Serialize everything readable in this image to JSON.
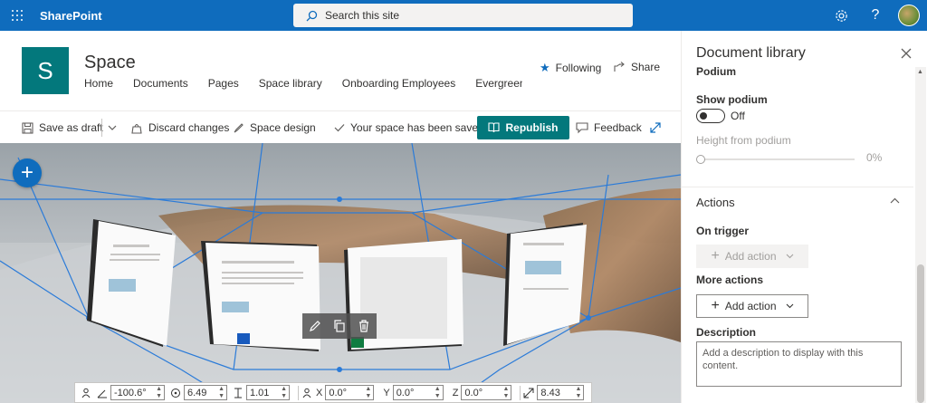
{
  "suitebar": {
    "brand": "SharePoint",
    "search_placeholder": "Search this site",
    "settings_icon": "gear-icon",
    "help_label": "?",
    "bg_color": "#0f6cbd"
  },
  "site": {
    "logo_letter": "S",
    "title": "Space",
    "nav": [
      "Home",
      "Documents",
      "Pages",
      "Space library",
      "Onboarding Employees",
      "Evergreen - Sta"
    ],
    "following_label": "Following",
    "share_label": "Share",
    "logo_color": "#03787c"
  },
  "commandbar": {
    "save_draft": "Save as draft",
    "discard": "Discard changes",
    "space_design": "Space design",
    "saved_status": "Your space has been saved",
    "republish": "Republish",
    "feedback": "Feedback"
  },
  "canvas": {
    "add_label": "+",
    "cards": [
      {
        "title": "SharePoint Spaces – Blog Series 1"
      },
      {
        "title": "SharePoint Spaces – Blog Series 2"
      }
    ]
  },
  "transform": {
    "tilt": "-100.6°",
    "radius": "6.49",
    "height": "1.01",
    "x_label": "X",
    "x": "0.0°",
    "y_label": "Y",
    "y": "0.0°",
    "z_label": "Z",
    "z": "0.0°",
    "scale": "8.43"
  },
  "panel": {
    "title": "Document library",
    "cut_heading": "Podium",
    "show_podium_label": "Show podium",
    "show_podium_value": "Off",
    "height_label": "Height from podium",
    "height_value": "0%",
    "height_fraction": 0,
    "actions_title": "Actions",
    "on_trigger_label": "On trigger",
    "on_trigger_button": "Add action",
    "more_actions_label": "More actions",
    "more_actions_button": "Add action",
    "description_label": "Description",
    "description_placeholder": "Add a description to display with this content."
  }
}
